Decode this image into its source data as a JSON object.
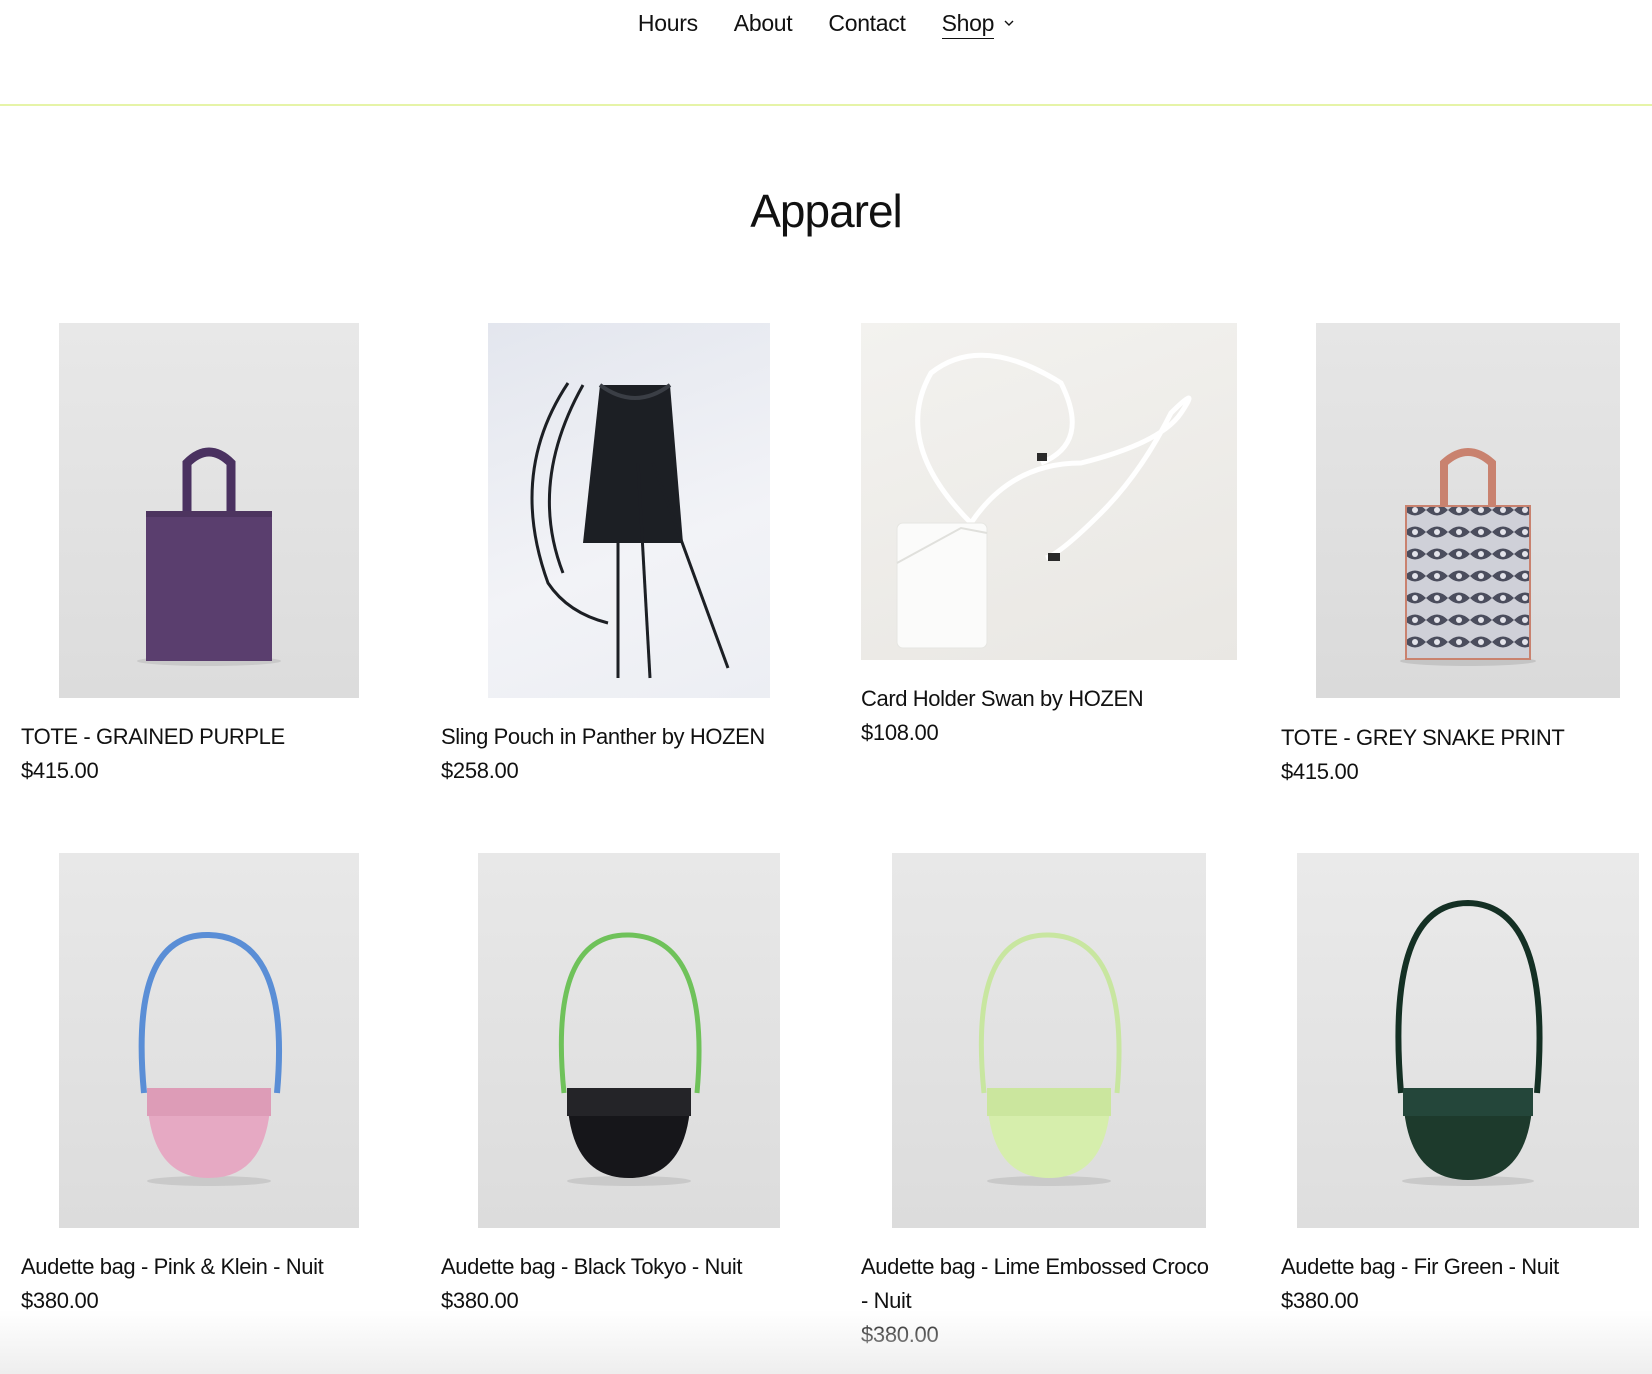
{
  "nav": {
    "items": [
      {
        "label": "Hours"
      },
      {
        "label": "About"
      },
      {
        "label": "Contact"
      },
      {
        "label": "Shop"
      }
    ]
  },
  "collection": {
    "title": "Apparel"
  },
  "products": [
    {
      "name": "TOTE - GRAINED PURPLE",
      "price": "$415.00",
      "image_alt": "purple tote bag",
      "color": "#5a3e6e"
    },
    {
      "name": "Sling Pouch in Panther by HOZEN",
      "price": "$258.00",
      "image_alt": "black sling pouch",
      "color": "#1c1f24"
    },
    {
      "name": "Card Holder Swan by HOZEN",
      "price": "$108.00",
      "image_alt": "white card holder",
      "color": "#f4f4f2"
    },
    {
      "name": "TOTE - GREY SNAKE PRINT",
      "price": "$415.00",
      "image_alt": "grey snake print tote",
      "color": "#8a8d99"
    },
    {
      "name": "Audette bag - Pink & Klein - Nuit",
      "price": "$380.00",
      "image_alt": "pink half-moon bag with blue strap",
      "color": "#e6a9c3",
      "strap": "#5a8ed6"
    },
    {
      "name": "Audette bag - Black Tokyo - Nuit",
      "price": "$380.00",
      "image_alt": "black half-moon bag with green strap",
      "color": "#16161a",
      "strap": "#6fc25a"
    },
    {
      "name": "Audette bag - Lime Embossed Croco - Nuit",
      "price": "$380.00",
      "image_alt": "lime croco half-moon bag",
      "color": "#d6eeac",
      "strap": "#c8e6a0"
    },
    {
      "name": "Audette bag - Fir Green - Nuit",
      "price": "$380.00",
      "image_alt": "fir green half-moon bag",
      "color": "#1d3a2c",
      "strap": "#143024"
    }
  ]
}
